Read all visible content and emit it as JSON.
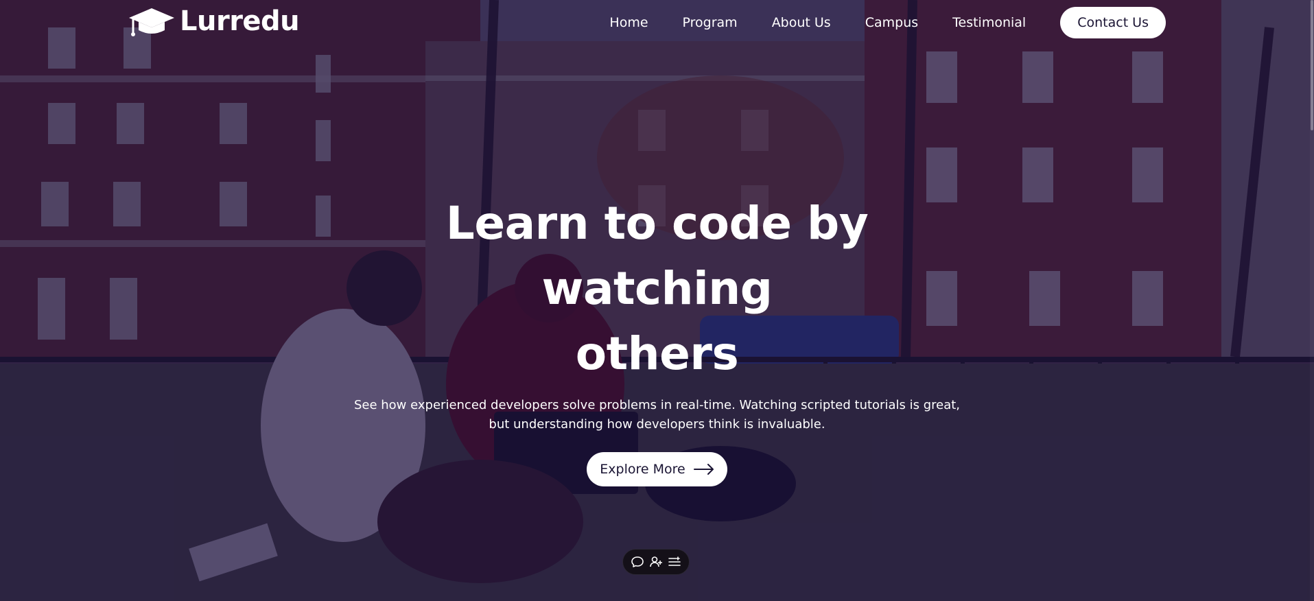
{
  "brand": {
    "name": "Lurredu",
    "logo_icon": "graduation-cap-icon"
  },
  "nav": {
    "items": [
      {
        "label": "Home"
      },
      {
        "label": "Program"
      },
      {
        "label": "About Us"
      },
      {
        "label": "Campus"
      },
      {
        "label": "Testimonial"
      }
    ],
    "contact_label": "Contact Us"
  },
  "hero": {
    "title_line1": "Learn to code by watching",
    "title_line2": "others",
    "subtitle_line1": "See how experienced developers solve problems in real-time. Watching scripted tutorials is great,",
    "subtitle_line2": "but understanding how developers think is invaluable.",
    "cta_label": "Explore More",
    "cta_icon": "arrow-right-icon",
    "background": "students-studying-on-campus-lawn-photo"
  },
  "toolbar": {
    "icons": [
      "chat-bubble-icon",
      "add-user-icon",
      "list-icon"
    ]
  },
  "colors": {
    "overlay": "#160a3a",
    "text": "#ffffff",
    "button_bg": "#ffffff",
    "button_text": "#1a1433",
    "toolbar_bg": "#141018"
  }
}
